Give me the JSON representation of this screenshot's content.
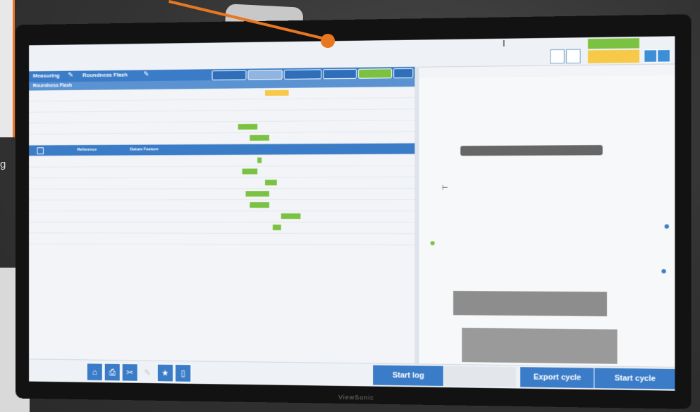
{
  "app": {
    "breadcrumb": "Measuring",
    "program": "Roundness Flash",
    "section": "Roundness Flash",
    "monitor_brand": "ViewSonic"
  },
  "status": {
    "green_label": "",
    "yellow_label": "",
    "value": ""
  },
  "filters": [
    "",
    "",
    "",
    "",
    "",
    ""
  ],
  "table": {
    "rows": [
      {
        "id": "",
        "name": "",
        "desc": "",
        "u": "",
        "tol": "",
        "nom": "",
        "meas": "",
        "dev": "",
        "r": "",
        "bar": {
          "color": "#f7c948",
          "start": 0.62,
          "width": 0.06
        },
        "selected": false
      },
      {
        "id": "",
        "name": "",
        "desc": "",
        "u": "",
        "tol": "",
        "nom": "",
        "meas": "",
        "dev": "",
        "r": "",
        "bar": null,
        "selected": false
      },
      {
        "id": "",
        "name": "",
        "desc": "",
        "u": "",
        "tol": "",
        "nom": "",
        "meas": "",
        "dev": "",
        "r": "",
        "bar": null,
        "selected": false
      },
      {
        "id": "",
        "name": "",
        "desc": "",
        "u": "",
        "tol": "",
        "nom": "",
        "meas": "",
        "dev": "",
        "r": "",
        "bar": {
          "color": "#7cc242",
          "start": 0.55,
          "width": 0.05
        },
        "selected": false
      },
      {
        "id": "",
        "name": "",
        "desc": "",
        "u": "",
        "tol": "",
        "nom": "",
        "meas": "",
        "dev": "",
        "r": "",
        "bar": {
          "color": "#7cc242",
          "start": 0.58,
          "width": 0.05
        },
        "selected": false
      },
      {
        "id": "",
        "name": "Reference",
        "desc": "Datum Feature",
        "u": "",
        "tol": "",
        "nom": "",
        "meas": "",
        "dev": "",
        "r": "",
        "bar": null,
        "selected": true
      },
      {
        "id": "",
        "name": "",
        "desc": "",
        "u": "",
        "tol": "",
        "nom": "",
        "meas": "",
        "dev": "",
        "r": "",
        "bar": {
          "color": "#7cc242",
          "start": 0.6,
          "width": 0.01
        },
        "selected": false
      },
      {
        "id": "",
        "name": "",
        "desc": "",
        "u": "",
        "tol": "",
        "nom": "",
        "meas": "",
        "dev": "",
        "r": "",
        "bar": {
          "color": "#7cc242",
          "start": 0.56,
          "width": 0.04
        },
        "selected": false
      },
      {
        "id": "",
        "name": "",
        "desc": "",
        "u": "",
        "tol": "",
        "nom": "",
        "meas": "",
        "dev": "",
        "r": "",
        "bar": {
          "color": "#7cc242",
          "start": 0.62,
          "width": 0.03
        },
        "selected": false
      },
      {
        "id": "",
        "name": "",
        "desc": "",
        "u": "",
        "tol": "",
        "nom": "",
        "meas": "",
        "dev": "",
        "r": "",
        "bar": {
          "color": "#7cc242",
          "start": 0.57,
          "width": 0.06
        },
        "selected": false
      },
      {
        "id": "",
        "name": "",
        "desc": "",
        "u": "",
        "tol": "",
        "nom": "",
        "meas": "",
        "dev": "",
        "r": "",
        "bar": {
          "color": "#7cc242",
          "start": 0.58,
          "width": 0.05
        },
        "selected": false
      },
      {
        "id": "",
        "name": "",
        "desc": "",
        "u": "",
        "tol": "",
        "nom": "",
        "meas": "",
        "dev": "",
        "r": "",
        "bar": {
          "color": "#7cc242",
          "start": 0.66,
          "width": 0.05
        },
        "selected": false
      },
      {
        "id": "",
        "name": "",
        "desc": "",
        "u": "",
        "tol": "",
        "nom": "",
        "meas": "",
        "dev": "",
        "r": "",
        "bar": {
          "color": "#7cc242",
          "start": 0.64,
          "width": 0.02
        },
        "selected": false
      },
      {
        "id": "",
        "name": "",
        "desc": "",
        "u": "",
        "tol": "",
        "nom": "",
        "meas": "",
        "dev": "",
        "r": "",
        "bar": null,
        "selected": false
      }
    ]
  },
  "bottom": {
    "start_log": "Start log",
    "middle_disabled": "",
    "export_cycle": "Export cycle",
    "start_cycle": "Start cycle"
  },
  "colors": {
    "accent": "#3a7cc7",
    "ok": "#7cc242",
    "warn": "#f7c948",
    "pointer": "#e87722"
  },
  "icons": [
    "home-icon",
    "print-icon",
    "tools-icon",
    "pencil-icon",
    "star-icon",
    "clipboard-icon"
  ]
}
